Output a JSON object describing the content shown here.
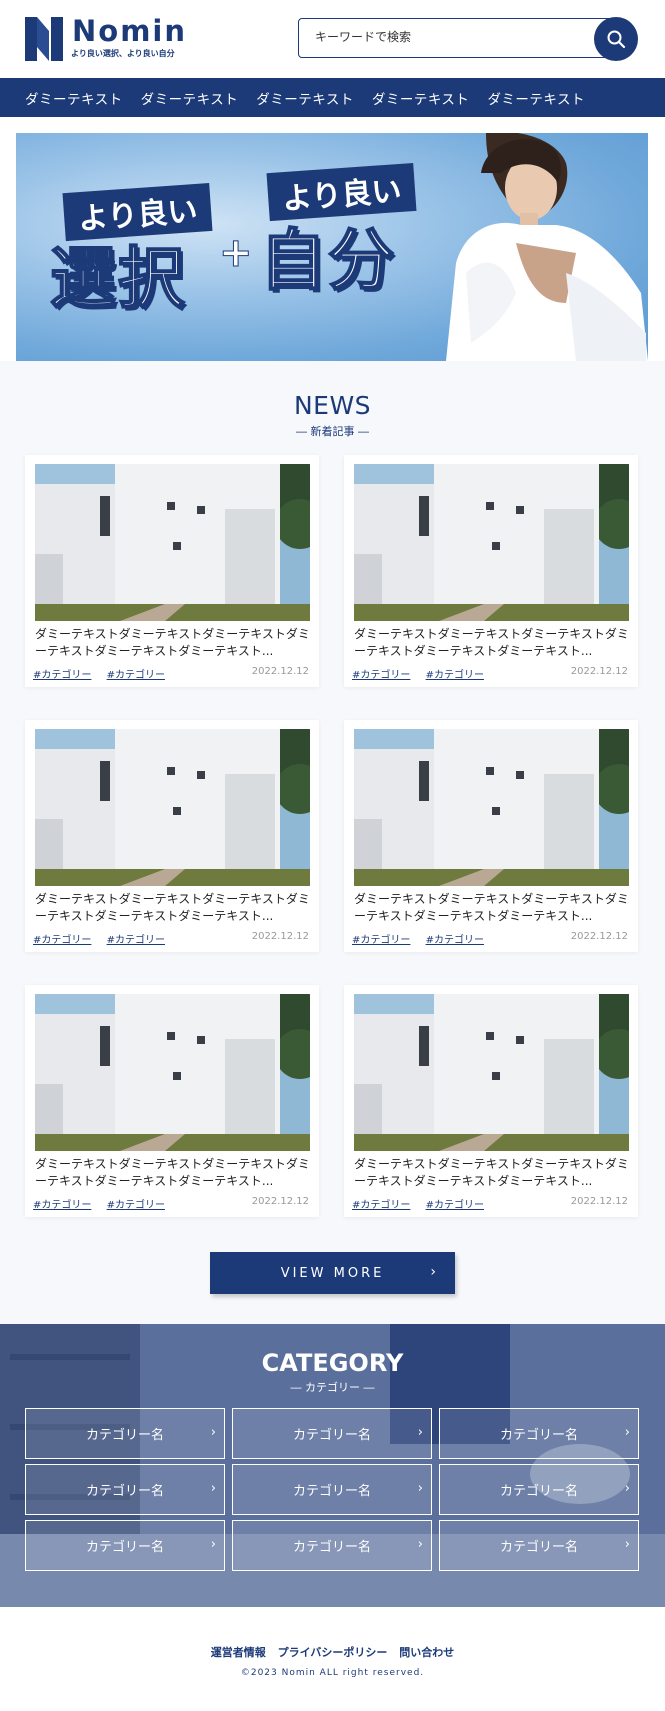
{
  "header": {
    "logo_name": "Nomin",
    "logo_tagline": "より良い選択、より良い自分",
    "search_placeholder": "キーワードで検索"
  },
  "nav": {
    "items": [
      "ダミーテキスト",
      "ダミーテキスト",
      "ダミーテキスト",
      "ダミーテキスト",
      "ダミーテキスト"
    ]
  },
  "hero": {
    "label_left": "より良い",
    "label_right": "より良い",
    "big_left": "選択",
    "plus": "+",
    "big_right": "自分"
  },
  "news": {
    "title": "NEWS",
    "subtitle": "― 新着記事 ―",
    "cards": [
      {
        "title": "ダミーテキストダミーテキストダミーテキストダミーテキストダミーテキストダミーテキスト...",
        "tag1": "#カテゴリー",
        "tag2": "#カテゴリー",
        "date": "2022.12.12"
      },
      {
        "title": "ダミーテキストダミーテキストダミーテキストダミーテキストダミーテキストダミーテキスト...",
        "tag1": "#カテゴリー",
        "tag2": "#カテゴリー",
        "date": "2022.12.12"
      },
      {
        "title": "ダミーテキストダミーテキストダミーテキストダミーテキストダミーテキストダミーテキスト...",
        "tag1": "#カテゴリー",
        "tag2": "#カテゴリー",
        "date": "2022.12.12"
      },
      {
        "title": "ダミーテキストダミーテキストダミーテキストダミーテキストダミーテキストダミーテキスト...",
        "tag1": "#カテゴリー",
        "tag2": "#カテゴリー",
        "date": "2022.12.12"
      },
      {
        "title": "ダミーテキストダミーテキストダミーテキストダミーテキストダミーテキストダミーテキスト...",
        "tag1": "#カテゴリー",
        "tag2": "#カテゴリー",
        "date": "2022.12.12"
      },
      {
        "title": "ダミーテキストダミーテキストダミーテキストダミーテキストダミーテキストダミーテキスト...",
        "tag1": "#カテゴリー",
        "tag2": "#カテゴリー",
        "date": "2022.12.12"
      }
    ],
    "more_label": "VIEW MORE",
    "more_chevron": "›"
  },
  "category": {
    "title": "CATEGORY",
    "subtitle": "― カテゴリー ―",
    "items": [
      "カテゴリー名",
      "カテゴリー名",
      "カテゴリー名",
      "カテゴリー名",
      "カテゴリー名",
      "カテゴリー名",
      "カテゴリー名",
      "カテゴリー名",
      "カテゴリー名"
    ],
    "chevron": "›"
  },
  "footer": {
    "links": [
      "運営者情報",
      "プライバシーポリシー",
      "問い合わせ"
    ],
    "copyright": "©2023 Nomin ALL right reserved."
  },
  "colors": {
    "brand": "#1c3a78",
    "page_bg": "#f6f8fc"
  }
}
